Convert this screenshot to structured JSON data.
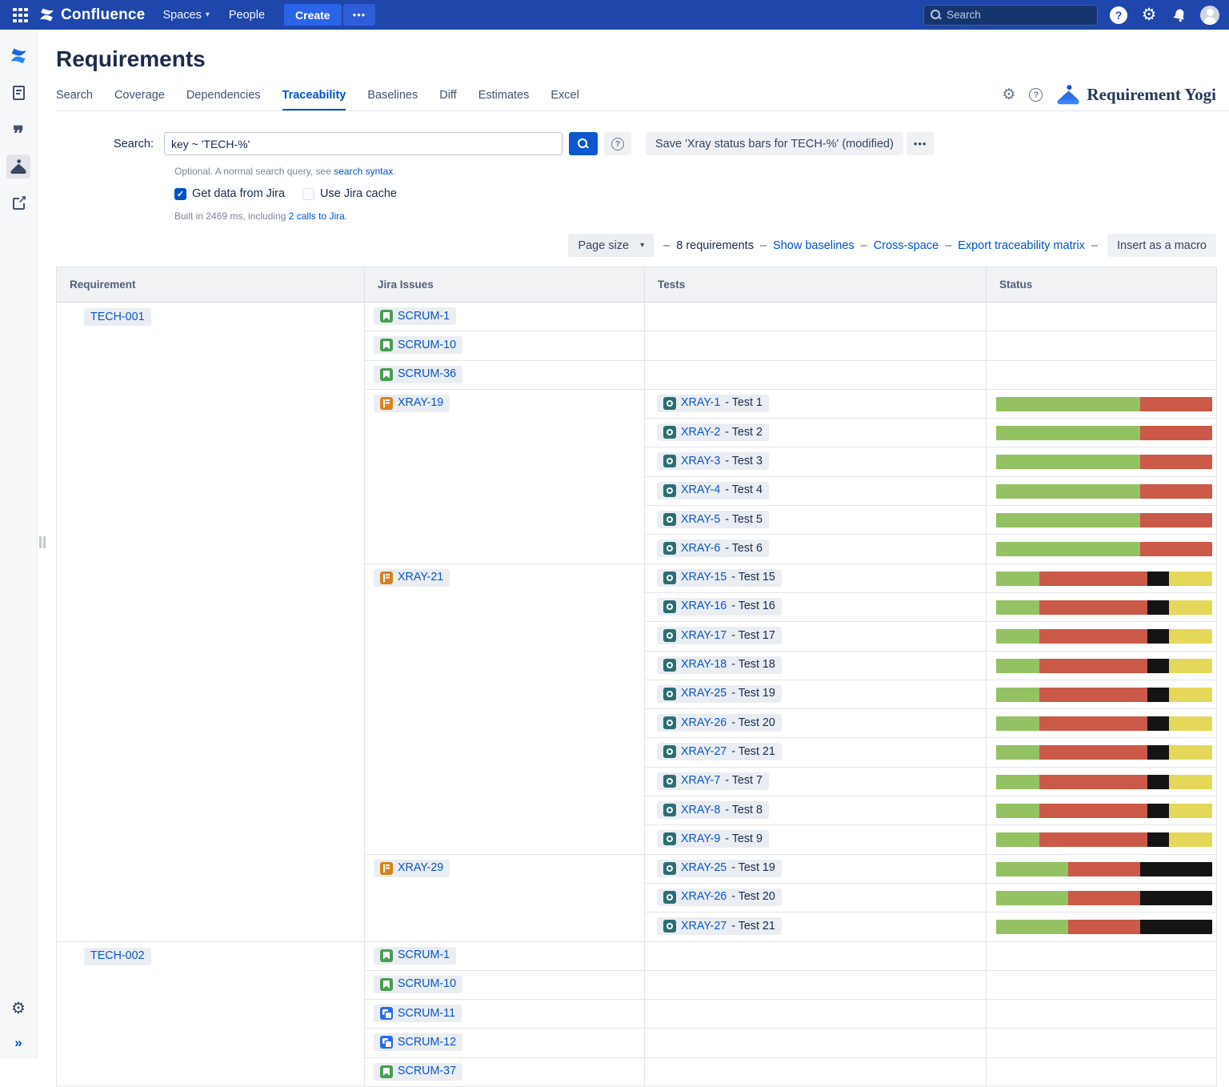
{
  "topnav": {
    "product": "Confluence",
    "spaces_label": "Spaces",
    "people_label": "People",
    "create_label": "Create",
    "more_label": "•••",
    "search_placeholder": "Search"
  },
  "page": {
    "title": "Requirements",
    "tabs": [
      {
        "label": "Search",
        "active": false
      },
      {
        "label": "Coverage",
        "active": false
      },
      {
        "label": "Dependencies",
        "active": false
      },
      {
        "label": "Traceability",
        "active": true
      },
      {
        "label": "Baselines",
        "active": false
      },
      {
        "label": "Diff",
        "active": false
      },
      {
        "label": "Estimates",
        "active": false
      },
      {
        "label": "Excel",
        "active": false
      }
    ],
    "brand": "Requirement Yogi"
  },
  "search": {
    "label": "Search:",
    "value": "key ~ 'TECH-%'",
    "save_button": "Save 'Xray status bars for TECH-%' (modified)",
    "more_button": "•••",
    "hint_prefix": "Optional. A normal search query, see ",
    "hint_link": "search syntax",
    "hint_suffix": ".",
    "checkbox_jira": {
      "label": "Get data from Jira",
      "checked": true
    },
    "checkbox_cache": {
      "label": "Use Jira cache",
      "checked": false
    },
    "check_glyph": "✓",
    "built_prefix": "Built in 2469 ms, including ",
    "built_link": "2 calls to Jira",
    "built_suffix": "."
  },
  "toolbar": {
    "page_size_label": "Page size",
    "sep": "–",
    "count": "8 requirements",
    "links": [
      "Show baselines",
      "Cross-space",
      "Export traceability matrix"
    ],
    "insert_macro_label": "Insert as a macro"
  },
  "table": {
    "headers": [
      "Requirement",
      "Jira Issues",
      "Tests",
      "Status"
    ],
    "status_colors": {
      "passed": "#94c262",
      "failed": "#ca5948",
      "blocked": "#141414",
      "todo": "#e5d75a"
    },
    "requirements": [
      {
        "key": "TECH-001",
        "groups": [
          {
            "issue": "SCRUM-1",
            "type": "story",
            "tests": []
          },
          {
            "issue": "SCRUM-10",
            "type": "story",
            "tests": []
          },
          {
            "issue": "SCRUM-36",
            "type": "story",
            "tests": []
          },
          {
            "issue": "XRAY-19",
            "type": "xray",
            "bar": [
              [
                "passed",
                66.5
              ],
              [
                "failed",
                33.5
              ]
            ],
            "tests": [
              {
                "key": "XRAY-1",
                "name": "Test 1"
              },
              {
                "key": "XRAY-2",
                "name": "Test 2"
              },
              {
                "key": "XRAY-3",
                "name": "Test 3"
              },
              {
                "key": "XRAY-4",
                "name": "Test 4"
              },
              {
                "key": "XRAY-5",
                "name": "Test 5"
              },
              {
                "key": "XRAY-6",
                "name": "Test 6"
              }
            ]
          },
          {
            "issue": "XRAY-21",
            "type": "xray",
            "bar": [
              [
                "passed",
                20
              ],
              [
                "failed",
                50
              ],
              [
                "blocked",
                10
              ],
              [
                "todo",
                20
              ]
            ],
            "tests": [
              {
                "key": "XRAY-15",
                "name": "Test 15"
              },
              {
                "key": "XRAY-16",
                "name": "Test 16"
              },
              {
                "key": "XRAY-17",
                "name": "Test 17"
              },
              {
                "key": "XRAY-18",
                "name": "Test 18"
              },
              {
                "key": "XRAY-25",
                "name": "Test 19"
              },
              {
                "key": "XRAY-26",
                "name": "Test 20"
              },
              {
                "key": "XRAY-27",
                "name": "Test 21"
              },
              {
                "key": "XRAY-7",
                "name": "Test 7"
              },
              {
                "key": "XRAY-8",
                "name": "Test 8"
              },
              {
                "key": "XRAY-9",
                "name": "Test 9"
              }
            ]
          },
          {
            "issue": "XRAY-29",
            "type": "xray",
            "bar": [
              [
                "passed",
                33.4
              ],
              [
                "failed",
                33.3
              ],
              [
                "blocked",
                33.3
              ]
            ],
            "tests": [
              {
                "key": "XRAY-25",
                "name": "Test 19"
              },
              {
                "key": "XRAY-26",
                "name": "Test 20"
              },
              {
                "key": "XRAY-27",
                "name": "Test 21"
              }
            ]
          }
        ]
      },
      {
        "key": "TECH-002",
        "groups": [
          {
            "issue": "SCRUM-1",
            "type": "story",
            "tests": []
          },
          {
            "issue": "SCRUM-10",
            "type": "story",
            "tests": []
          },
          {
            "issue": "SCRUM-11",
            "type": "subtask",
            "tests": []
          },
          {
            "issue": "SCRUM-12",
            "type": "subtask",
            "tests": []
          },
          {
            "issue": "SCRUM-37",
            "type": "story",
            "tests": []
          }
        ]
      }
    ]
  }
}
